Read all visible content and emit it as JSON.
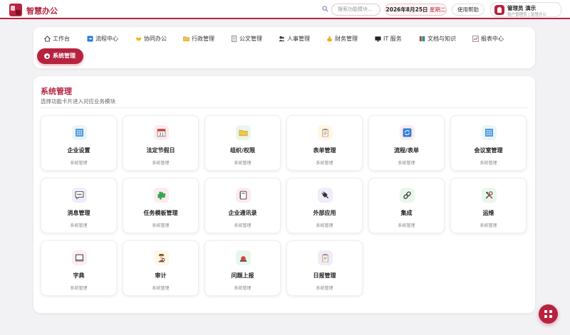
{
  "app": {
    "title": "智慧办公"
  },
  "search": {
    "placeholder": "搜索功能模块..."
  },
  "date": {
    "text": "2026年8月25日",
    "weekday": "星期二"
  },
  "help": {
    "label": "使用帮助"
  },
  "user": {
    "name": "管理员 演示",
    "sub": "租户管理员 | 智慧办公"
  },
  "nav": {
    "items": [
      {
        "label": "工作台",
        "icon": "home-icon"
      },
      {
        "label": "流程中心",
        "icon": "flow-icon"
      },
      {
        "label": "协同办公",
        "icon": "handshake-icon"
      },
      {
        "label": "行政管理",
        "icon": "folder-icon"
      },
      {
        "label": "公文管理",
        "icon": "document-icon"
      },
      {
        "label": "人事管理",
        "icon": "people-icon"
      },
      {
        "label": "财务管理",
        "icon": "money-bag-icon"
      },
      {
        "label": "IT 服务",
        "icon": "computer-icon"
      },
      {
        "label": "文档与知识",
        "icon": "books-icon"
      },
      {
        "label": "报表中心",
        "icon": "chart-icon"
      }
    ],
    "active": {
      "label": "系统管理",
      "icon": "gear-icon"
    }
  },
  "main": {
    "title": "系统管理",
    "subtitle": "选择功能卡片进入对应业务模块",
    "tiles": [
      {
        "name": "企业设置",
        "category": "系统管理",
        "icon": "building-icon"
      },
      {
        "name": "法定节假日",
        "category": "系统管理",
        "icon": "calendar-icon"
      },
      {
        "name": "组织/权限",
        "category": "系统管理",
        "icon": "folder-icon"
      },
      {
        "name": "表单管理",
        "category": "系统管理",
        "icon": "clipboard-icon"
      },
      {
        "name": "流程/表单",
        "category": "系统管理",
        "icon": "refresh-icon"
      },
      {
        "name": "会议室管理",
        "category": "系统管理",
        "icon": "building-icon"
      },
      {
        "name": "消息管理",
        "category": "系统管理",
        "icon": "chat-bubble-icon"
      },
      {
        "name": "任务模板管理",
        "category": "系统管理",
        "icon": "puzzle-icon"
      },
      {
        "name": "企业通讯录",
        "category": "系统管理",
        "icon": "contacts-icon"
      },
      {
        "name": "外部应用",
        "category": "系统管理",
        "icon": "plug-icon"
      },
      {
        "name": "集成",
        "category": "系统管理",
        "icon": "link-icon"
      },
      {
        "name": "运维",
        "category": "系统管理",
        "icon": "tools-icon"
      },
      {
        "name": "字典",
        "category": "系统管理",
        "icon": "book-icon"
      },
      {
        "name": "审计",
        "category": "系统管理",
        "icon": "detective-icon"
      },
      {
        "name": "问题上报",
        "category": "系统管理",
        "icon": "siren-icon"
      },
      {
        "name": "日报管理",
        "category": "系统管理",
        "icon": "clipboard-icon"
      }
    ]
  },
  "colors": {
    "accent": "#b7233f",
    "background": "#f2f2f4"
  }
}
